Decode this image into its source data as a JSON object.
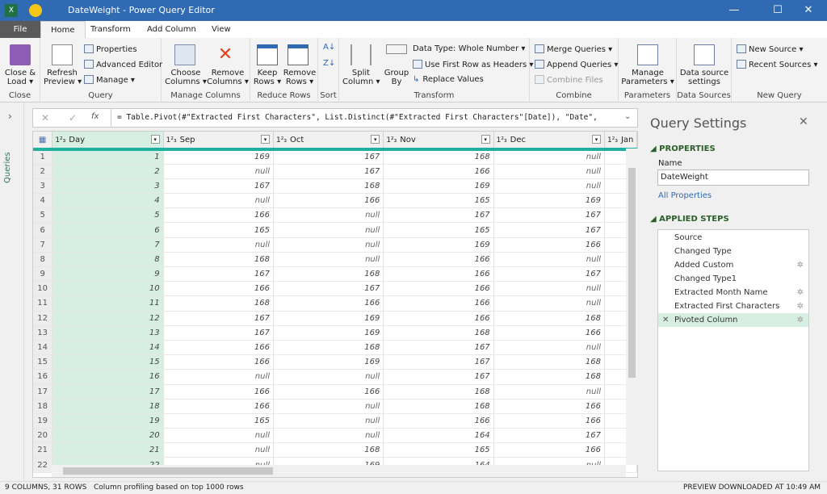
{
  "window": {
    "title": "DateWeight - Power Query Editor",
    "minimize": "—",
    "maximize": "☐",
    "close": "✕"
  },
  "tabs": [
    "File",
    "Home",
    "Transform",
    "Add Column",
    "View"
  ],
  "ribbon": {
    "close": {
      "button": "Close &\nLoad ▾",
      "label": "Close"
    },
    "query": {
      "refresh": "Refresh\nPreview ▾",
      "properties": "Properties",
      "advanced_editor": "Advanced Editor",
      "manage": "Manage ▾",
      "label": "Query"
    },
    "manage_columns": {
      "choose": "Choose\nColumns ▾",
      "remove": "Remove\nColumns ▾",
      "label": "Manage Columns"
    },
    "reduce_rows": {
      "keep": "Keep\nRows ▾",
      "remove": "Remove\nRows ▾",
      "label": "Reduce Rows"
    },
    "sort": {
      "label": "Sort"
    },
    "transform": {
      "split": "Split\nColumn ▾",
      "group": "Group\nBy",
      "data_type": "Data Type: Whole Number ▾",
      "first_row": "Use First Row as Headers ▾",
      "replace": "Replace Values",
      "label": "Transform"
    },
    "combine": {
      "merge": "Merge Queries ▾",
      "append": "Append Queries ▾",
      "combine_files": "Combine Files",
      "label": "Combine"
    },
    "parameters": {
      "manage": "Manage\nParameters ▾",
      "label": "Parameters"
    },
    "data_sources": {
      "settings": "Data source\nsettings",
      "label": "Data Sources"
    },
    "new_query": {
      "new_source": "New Source ▾",
      "recent": "Recent Sources ▾",
      "label": "New Query"
    }
  },
  "left_nav": {
    "label": "Queries"
  },
  "formula": {
    "text": "= Table.Pivot(#\"Extracted First Characters\", List.Distinct(#\"Extracted First Characters\"[Date]), \"Date\",",
    "fx": "fx"
  },
  "grid": {
    "columns": [
      "Day",
      "Sep",
      "Oct",
      "Nov",
      "Dec",
      "Jan"
    ],
    "type_icon": "1²₃",
    "rows": [
      [
        1,
        "169",
        "167",
        "168",
        "null"
      ],
      [
        2,
        "null",
        "167",
        "166",
        "null"
      ],
      [
        3,
        "167",
        "168",
        "169",
        "null"
      ],
      [
        4,
        "null",
        "166",
        "165",
        "169"
      ],
      [
        5,
        "166",
        "null",
        "167",
        "167"
      ],
      [
        6,
        "165",
        "null",
        "165",
        "167"
      ],
      [
        7,
        "null",
        "null",
        "169",
        "166"
      ],
      [
        8,
        "168",
        "null",
        "166",
        "null"
      ],
      [
        9,
        "167",
        "168",
        "166",
        "167"
      ],
      [
        10,
        "166",
        "167",
        "166",
        "null"
      ],
      [
        11,
        "168",
        "166",
        "166",
        "null"
      ],
      [
        12,
        "167",
        "169",
        "166",
        "168"
      ],
      [
        13,
        "167",
        "169",
        "168",
        "166"
      ],
      [
        14,
        "166",
        "168",
        "167",
        "null"
      ],
      [
        15,
        "166",
        "169",
        "167",
        "168"
      ],
      [
        16,
        "null",
        "null",
        "167",
        "168"
      ],
      [
        17,
        "166",
        "166",
        "168",
        "null"
      ],
      [
        18,
        "166",
        "null",
        "168",
        "166"
      ],
      [
        19,
        "165",
        "null",
        "166",
        "166"
      ],
      [
        20,
        "null",
        "null",
        "164",
        "167"
      ],
      [
        21,
        "null",
        "168",
        "165",
        "166"
      ],
      [
        22,
        "null",
        "169",
        "164",
        "null"
      ]
    ]
  },
  "query_settings": {
    "title": "Query Settings",
    "properties": "PROPERTIES",
    "name_label": "Name",
    "name_value": "DateWeight",
    "all_properties": "All Properties",
    "applied_steps": "APPLIED STEPS",
    "steps": [
      {
        "name": "Source",
        "gear": false
      },
      {
        "name": "Changed Type",
        "gear": false
      },
      {
        "name": "Added Custom",
        "gear": true
      },
      {
        "name": "Changed Type1",
        "gear": false
      },
      {
        "name": "Extracted Month Name",
        "gear": true
      },
      {
        "name": "Extracted First Characters",
        "gear": true
      },
      {
        "name": "Pivoted Column",
        "gear": true,
        "selected": true
      }
    ]
  },
  "status": {
    "left": "9 COLUMNS, 31 ROWS",
    "profiling": "Column profiling based on top 1000 rows",
    "right": "PREVIEW DOWNLOADED AT 10:49 AM"
  },
  "colors": {
    "title_bar": "#2f6ab3",
    "selected_column": "#d6efe2",
    "quality_bar": "#1fb0a0"
  }
}
